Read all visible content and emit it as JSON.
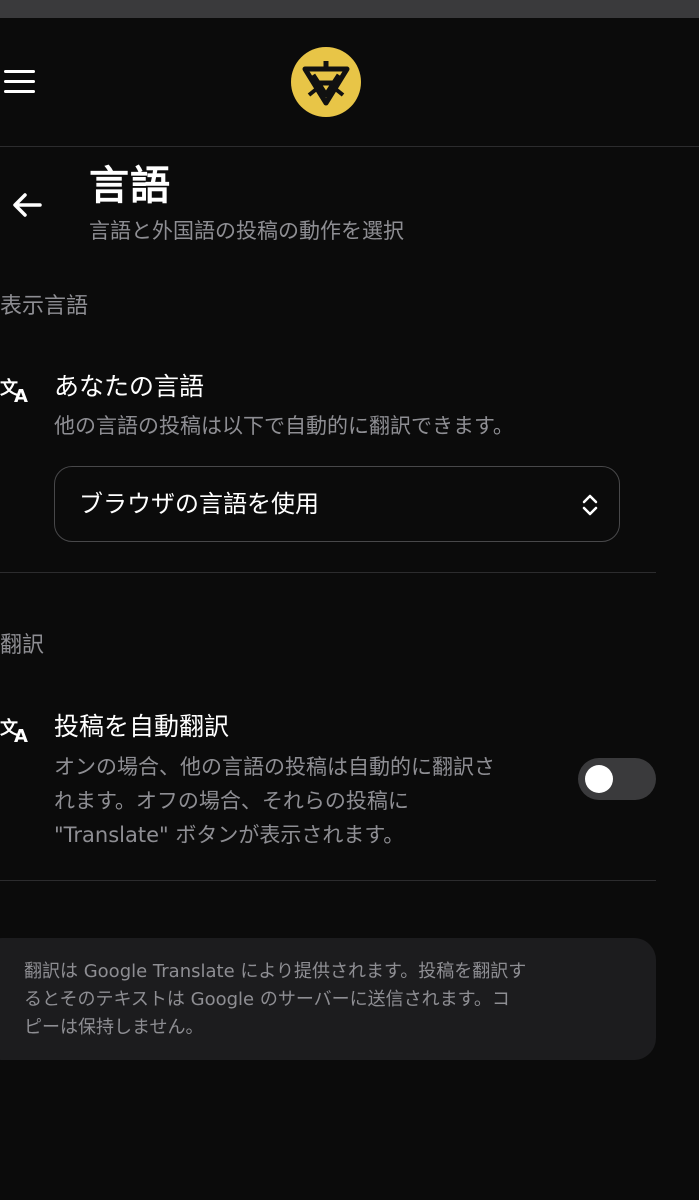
{
  "header": {
    "menu_icon": "hamburger-menu-icon",
    "logo_icon": "app-logo-icon"
  },
  "page": {
    "back_icon": "back-arrow-icon",
    "title": "言語",
    "subtitle": "言語と外国語の投稿の動作を選択"
  },
  "display_language_section": {
    "heading": "表示言語",
    "item": {
      "icon": "translate-icon",
      "title": "あなたの言語",
      "description": "他の言語の投稿は以下で自動的に翻訳できます。",
      "select_value": "ブラウザの言語を使用",
      "select_icon": "chevron-up-down-icon"
    }
  },
  "translation_section": {
    "heading": "翻訳",
    "item": {
      "icon": "translate-icon",
      "title": "投稿を自動翻訳",
      "description_lines": [
        "オンの場合、他の言語の投稿は自動的に翻訳さ",
        "れます。オフの場合、それらの投稿に",
        "\"Translate\" ボタンが表示されます。"
      ],
      "toggle_on": false
    }
  },
  "info": {
    "lines": [
      "翻訳は Google Translate により提供されます。投稿を翻訳す",
      "るとそのテキストは Google のサーバーに送信されます。コ",
      "ピーは保持しません。"
    ]
  },
  "colors": {
    "background": "#0b0b0b",
    "text_primary": "#ffffff",
    "text_secondary": "#8e8e93",
    "logo_gold": "#e8c547",
    "toggle_off": "#3a3a3c",
    "info_bg": "#1c1c1e"
  }
}
